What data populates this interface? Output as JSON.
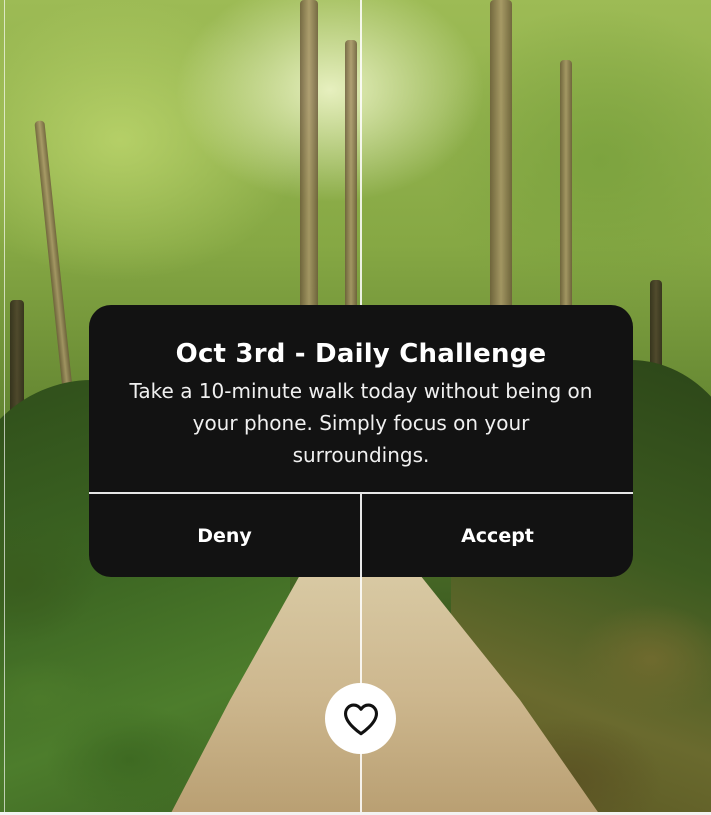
{
  "dialog": {
    "title": "Oct 3rd - Daily Challenge",
    "body": "Take a 10-minute walk today without being on your phone. Simply focus on your surroundings.",
    "deny_label": "Deny",
    "accept_label": "Accept"
  },
  "actions": {
    "like_icon": "heart-icon"
  },
  "colors": {
    "dialog_background": "#121212",
    "text": "#ffffff",
    "divider": "#e6e6e6"
  }
}
